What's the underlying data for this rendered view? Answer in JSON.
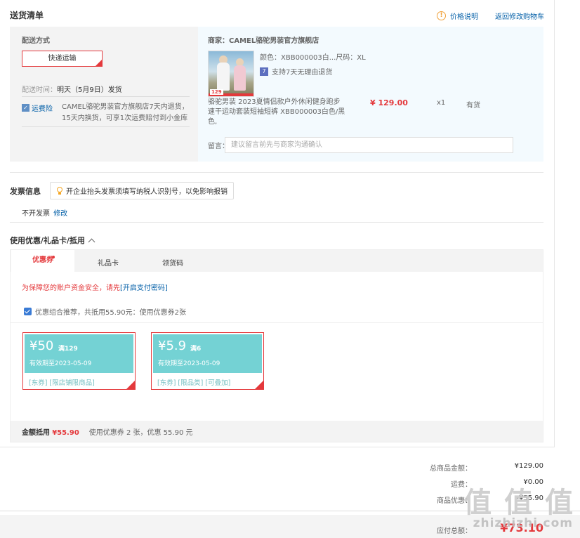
{
  "header": {
    "title": "送货清单",
    "price_info": "价格说明",
    "back_to_cart": "返回修改购物车"
  },
  "shipping": {
    "mode_label": "配送方式",
    "mode_value": "快递运输",
    "time_label": "配送时间：",
    "time_value": "明天（5月9日）发货",
    "insurance_label": "运费险",
    "insurance_text": "CAMEL骆驼男装官方旗舰店7天内退货，15天内换货，可享1次运费赔付到小金库"
  },
  "product": {
    "shop": "商家：CAMEL骆驼男装官方旗舰店",
    "image_tag": "129",
    "attributes": "颜色：XBB000003白...尺码：XL",
    "return_policy": "支持7天无理由退货",
    "name": "骆驼男装 2023夏情侣款户外休闲健身跑步速干运动套装短袖短裤 XBB000003白色/黑色,",
    "price": "¥ 129.00",
    "qty": "x1",
    "stock": "有货",
    "message_label": "留言：",
    "message_placeholder": "建议留言前先与商家沟通确认"
  },
  "invoice": {
    "title": "发票信息",
    "tip": "开企业抬头发票须填写纳税人识别号，以免影响报销",
    "status": "不开发票",
    "edit": "修改"
  },
  "coupon": {
    "title": "使用优惠/礼品卡/抵用",
    "tabs": [
      "优惠券",
      "礼品卡",
      "领货码"
    ],
    "warning_prefix": "为保障您的账户资金安全，请先",
    "warning_link": "[开启支付密码]",
    "recommend_text": "优惠组合推荐，共抵用55.90元：使用优惠券2张",
    "items": [
      {
        "amount": "¥50",
        "condition": "满129",
        "expiry": "有效期至2023-05-09",
        "tags": "[东券]  [限店铺限商品]"
      },
      {
        "amount": "¥5.9",
        "condition": "满6",
        "expiry": "有效期至2023-05-09",
        "tags": "[东券]  [限品类]  [可叠加]"
      }
    ],
    "footer_label": "金额抵用",
    "footer_amount": "¥55.90",
    "footer_text": "使用优惠券 2 张，优惠 55.90 元"
  },
  "totals": {
    "goods_label": "总商品金额：",
    "goods_value": "¥129.00",
    "freight_label": "运费：",
    "freight_value": "¥0.00",
    "discount_label": "商品优惠：",
    "discount_value": "-¥55.90",
    "pay_label": "应付总额：",
    "pay_value": "¥73.10"
  },
  "watermark": {
    "text": "值 值 值",
    "url": "zhizhizhi.com"
  }
}
